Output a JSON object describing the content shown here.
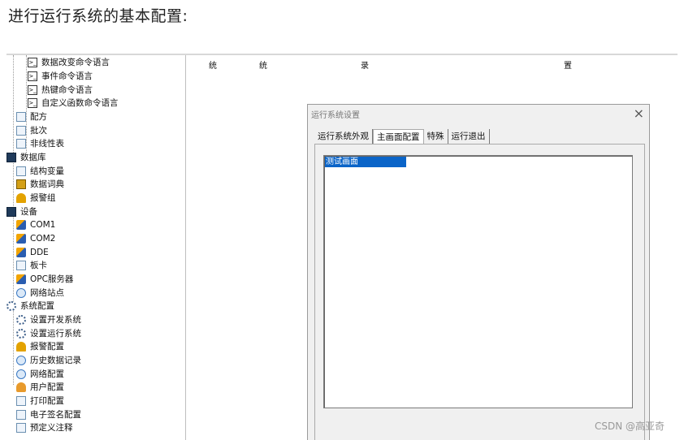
{
  "article": {
    "intro_text": "进行运行系统的基本配置:"
  },
  "tree": {
    "items": [
      {
        "label": "数据改变命令语言",
        "icon": "command-icon",
        "name": "tree-item-data-change-command"
      },
      {
        "label": "事件命令语言",
        "icon": "command-icon",
        "name": "tree-item-event-command"
      },
      {
        "label": "热键命令语言",
        "icon": "command-icon",
        "name": "tree-item-hotkey-command"
      },
      {
        "label": "自定义函数命令语言",
        "icon": "command-icon",
        "name": "tree-item-custom-function-command"
      },
      {
        "label": "配方",
        "icon": "recipe-icon",
        "name": "tree-item-recipe"
      },
      {
        "label": "批次",
        "icon": "document-icon",
        "name": "tree-item-batch"
      },
      {
        "label": "非线性表",
        "icon": "table-icon",
        "name": "tree-item-nonlinear-table"
      },
      {
        "label": "数据库",
        "icon": "database-icon",
        "name": "tree-item-database"
      },
      {
        "label": "结构变量",
        "icon": "structure-icon",
        "name": "tree-item-struct-variable"
      },
      {
        "label": "数据词典",
        "icon": "dictionary-icon",
        "name": "tree-item-data-dictionary"
      },
      {
        "label": "报警组",
        "icon": "alarm-icon",
        "name": "tree-item-alarm-group"
      },
      {
        "label": "设备",
        "icon": "device-icon",
        "name": "tree-item-device"
      },
      {
        "label": "COM1",
        "icon": "com-port-icon",
        "name": "tree-item-com1"
      },
      {
        "label": "COM2",
        "icon": "com-port-icon",
        "name": "tree-item-com2"
      },
      {
        "label": "DDE",
        "icon": "dde-icon",
        "name": "tree-item-dde"
      },
      {
        "label": "板卡",
        "icon": "board-icon",
        "name": "tree-item-board"
      },
      {
        "label": "OPC服务器",
        "icon": "opc-icon",
        "name": "tree-item-opc-server"
      },
      {
        "label": "网络站点",
        "icon": "network-site-icon",
        "name": "tree-item-network-site"
      },
      {
        "label": "系统配置",
        "icon": "system-config-icon",
        "name": "tree-item-system-config"
      },
      {
        "label": "设置开发系统",
        "icon": "gear-icon",
        "name": "tree-item-dev-system-settings"
      },
      {
        "label": "设置运行系统",
        "icon": "run-settings-icon",
        "name": "tree-item-run-system-settings"
      },
      {
        "label": "报警配置",
        "icon": "alarm-icon",
        "name": "tree-item-alarm-config"
      },
      {
        "label": "历史数据记录",
        "icon": "history-icon",
        "name": "tree-item-history-records"
      },
      {
        "label": "网络配置",
        "icon": "globe-icon",
        "name": "tree-item-network-config"
      },
      {
        "label": "用户配置",
        "icon": "user-icon",
        "name": "tree-item-user-config"
      },
      {
        "label": "打印配置",
        "icon": "printer-icon",
        "name": "tree-item-print-config"
      },
      {
        "label": "电子签名配置",
        "icon": "signature-icon",
        "name": "tree-item-e-signature-config"
      },
      {
        "label": "预定义注释",
        "icon": "note-icon",
        "name": "tree-item-predefined-notes"
      }
    ]
  },
  "main": {
    "column_headers": [
      "统",
      "统",
      "录",
      "置"
    ]
  },
  "dialog": {
    "title": "运行系统设置",
    "close_glyph": "×",
    "tabs": [
      "运行系统外观",
      "主画面配置",
      "特殊",
      "运行退出"
    ],
    "active_tab": 1,
    "list_items": [
      "测试画面"
    ]
  },
  "watermark": "CSDN @高亚奇"
}
